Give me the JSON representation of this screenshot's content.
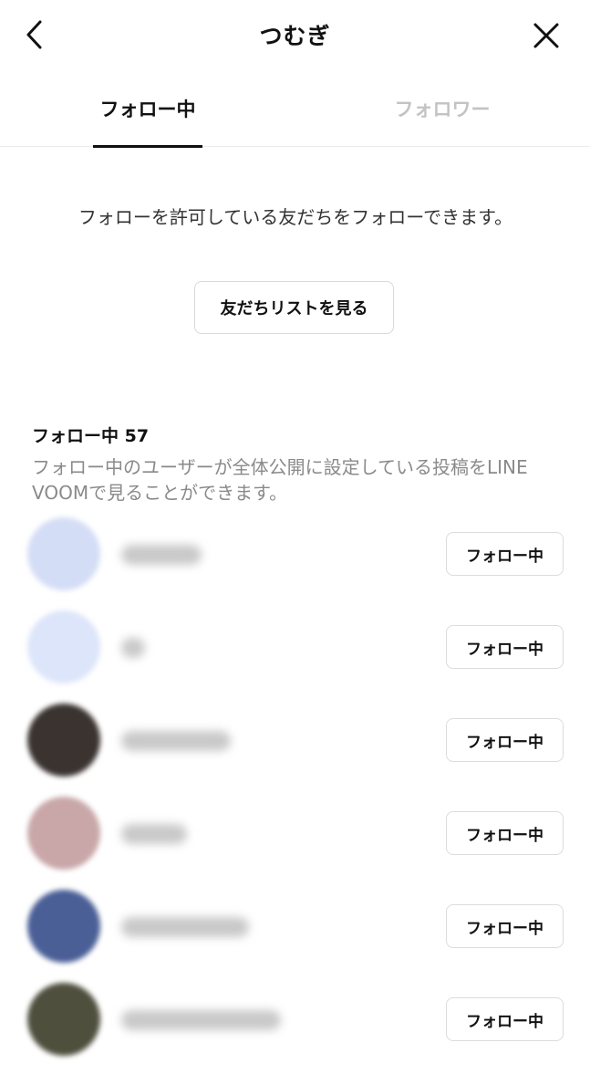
{
  "header": {
    "title": "つむぎ",
    "back_icon": "chevron-left-icon",
    "close_icon": "close-icon"
  },
  "tabs": [
    {
      "label": "フォロー中",
      "active": true
    },
    {
      "label": "フォロワー",
      "active": false
    }
  ],
  "notice": {
    "text": "フォローを許可している友だちをフォローできます。",
    "button_label": "友だちリストを見る"
  },
  "following": {
    "title": "フォロー中 57",
    "description": "フォロー中のユーザーが全体公開に設定している投稿をLINE VOOMで見ることができます。",
    "users": [
      {
        "avatar_color": "#d4ddf6",
        "follow_label": "フォロー中"
      },
      {
        "avatar_color": "#dde5fa",
        "follow_label": "フォロー中"
      },
      {
        "avatar_color": "#3a3330",
        "follow_label": "フォロー中"
      },
      {
        "avatar_color": "#c9a7a9",
        "follow_label": "フォロー中"
      },
      {
        "avatar_color": "#4a5f96",
        "follow_label": "フォロー中"
      },
      {
        "avatar_color": "#4f4f3e",
        "follow_label": "フォロー中"
      }
    ]
  }
}
